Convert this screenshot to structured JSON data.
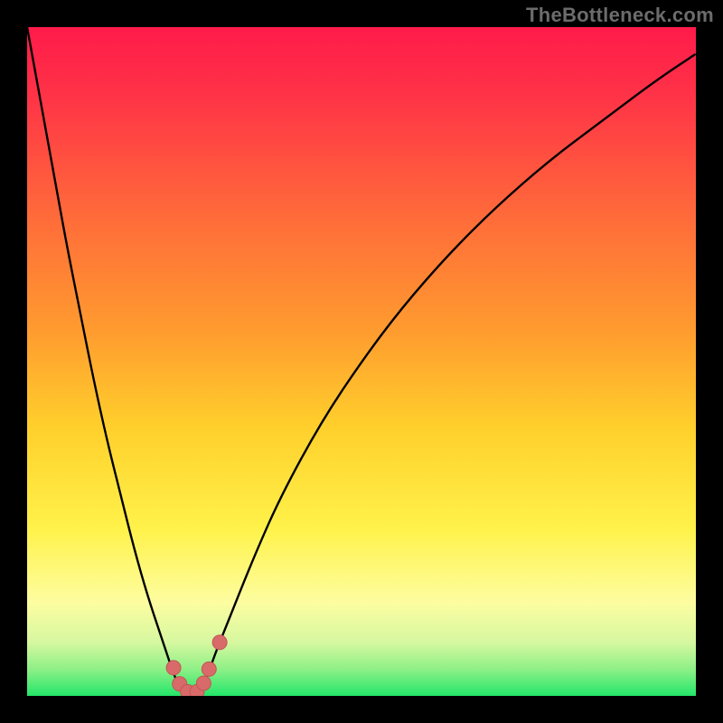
{
  "watermark": "TheBottleneck.com",
  "colors": {
    "frame": "#000000",
    "curve": "#000000",
    "marker_fill": "#d96a6a",
    "marker_stroke": "#c25555",
    "gradient_stops": [
      {
        "offset": 0.0,
        "color": "#ff1b4a"
      },
      {
        "offset": 0.1,
        "color": "#ff3247"
      },
      {
        "offset": 0.28,
        "color": "#ff6a3a"
      },
      {
        "offset": 0.45,
        "color": "#ff9a2f"
      },
      {
        "offset": 0.6,
        "color": "#ffd02c"
      },
      {
        "offset": 0.75,
        "color": "#fff24a"
      },
      {
        "offset": 0.86,
        "color": "#fdfda0"
      },
      {
        "offset": 0.92,
        "color": "#d6f8a0"
      },
      {
        "offset": 0.96,
        "color": "#8ef086"
      },
      {
        "offset": 1.0,
        "color": "#23e66a"
      }
    ]
  },
  "chart_data": {
    "type": "line",
    "title": "",
    "xlabel": "",
    "ylabel": "",
    "xlim": [
      0,
      100
    ],
    "ylim": [
      0,
      100
    ],
    "grid": false,
    "x": [
      0,
      2,
      4,
      6,
      8,
      10,
      12,
      14,
      16,
      18,
      20,
      21,
      22,
      23,
      24,
      25,
      26,
      27,
      28,
      30,
      34,
      38,
      44,
      50,
      56,
      63,
      70,
      78,
      86,
      94,
      100
    ],
    "series": [
      {
        "name": "bottleneck-curve",
        "values": [
          100,
          89,
          78,
          67,
          57,
          47,
          38,
          30,
          22,
          15,
          9,
          6,
          3,
          1,
          0,
          0,
          1,
          3,
          6,
          11,
          21,
          30,
          41,
          50,
          58,
          66,
          73,
          80,
          86,
          92,
          96
        ]
      }
    ],
    "markers": [
      {
        "x": 21.9,
        "y": 4.2
      },
      {
        "x": 22.8,
        "y": 1.8
      },
      {
        "x": 24.0,
        "y": 0.6
      },
      {
        "x": 25.4,
        "y": 0.6
      },
      {
        "x": 26.4,
        "y": 1.9
      },
      {
        "x": 27.2,
        "y": 4.0
      },
      {
        "x": 28.8,
        "y": 8.0
      }
    ]
  }
}
